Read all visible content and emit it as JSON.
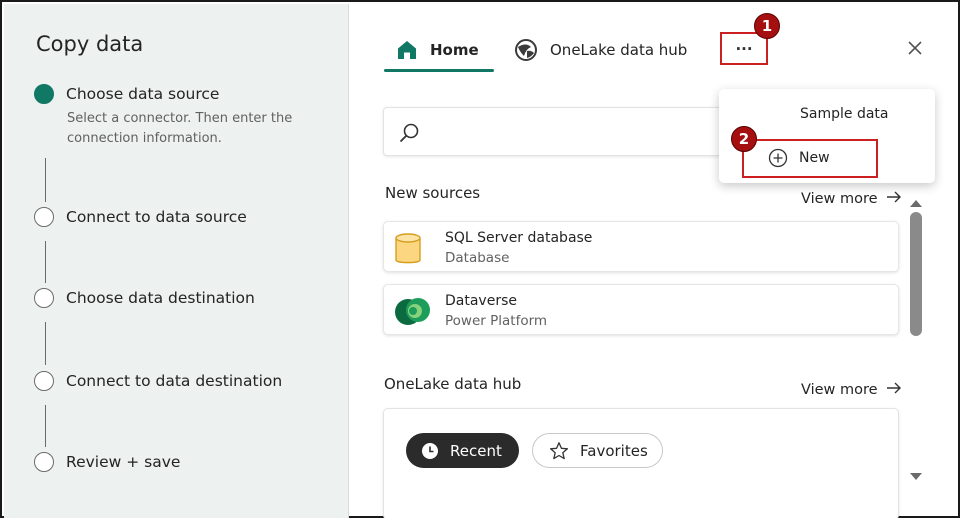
{
  "wizard": {
    "title": "Copy data",
    "steps": [
      {
        "label": "Choose data source",
        "description": "Select a connector. Then enter the connection information.",
        "active": true
      },
      {
        "label": "Connect to data source",
        "active": false
      },
      {
        "label": "Choose data destination",
        "active": false
      },
      {
        "label": "Connect to data destination",
        "active": false
      },
      {
        "label": "Review + save",
        "active": false
      }
    ]
  },
  "tabs": {
    "home": "Home",
    "onelake": "OneLake data hub",
    "more": "···"
  },
  "search": {
    "placeholder": ""
  },
  "new_sources": {
    "title": "New sources",
    "view_more": "View more",
    "items": [
      {
        "title": "SQL Server database",
        "subtitle": "Database",
        "icon": "sql-database-icon"
      },
      {
        "title": "Dataverse",
        "subtitle": "Power Platform",
        "icon": "dataverse-icon"
      }
    ]
  },
  "onelake_hub": {
    "title": "OneLake data hub",
    "view_more": "View more",
    "filters": {
      "recent": "Recent",
      "favorites": "Favorites"
    }
  },
  "dropdown": {
    "sample_data": "Sample data",
    "new": "New"
  },
  "annotations": {
    "badge_1": "1",
    "badge_2": "2"
  },
  "colors": {
    "accent": "#117865",
    "highlight": "#cc1f1f",
    "badge": "#a50f0f"
  }
}
